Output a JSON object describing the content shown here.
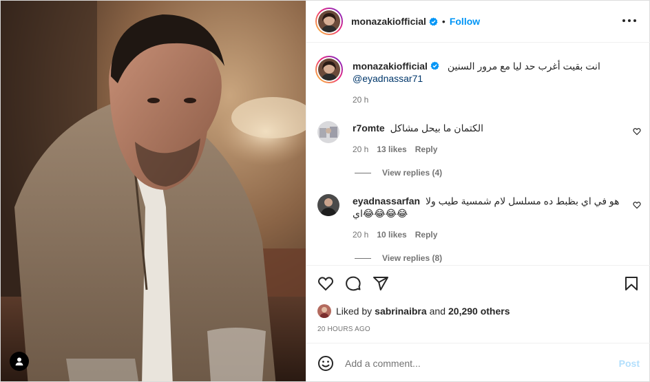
{
  "post": {
    "username": "monazakiofficial",
    "follow_label": "Follow",
    "separator": "•",
    "verified_icon": "verified-badge-icon",
    "more_icon": "more-options-icon"
  },
  "caption": {
    "username": "monazakiofficial",
    "text": "انت بقيت أغرب حد ليا مع مرور السنين",
    "mention": "@eyadnassar71",
    "time": "20 h"
  },
  "comments": [
    {
      "username": "r7omte",
      "text": "الكتمان ما بيحل مشاكل",
      "time": "20 h",
      "likes": "13 likes",
      "reply_label": "Reply",
      "view_replies": "View replies (4)"
    },
    {
      "username": "eyadnassarfan",
      "text": "هو في اي بظبط ده مسلسل لام شمسية طيب ولا اي😂😂😂😂",
      "time": "20 h",
      "likes": "10 likes",
      "reply_label": "Reply",
      "view_replies": "View replies (8)"
    }
  ],
  "actions": {
    "like_icon": "heart-icon",
    "comment_icon": "comment-icon",
    "share_icon": "share-icon",
    "save_icon": "bookmark-icon"
  },
  "likes": {
    "prefix": "Liked by",
    "user": "sabrinaibra",
    "and": "and",
    "others": "20,290 others"
  },
  "timestamp": "20 HOURS AGO",
  "add_comment": {
    "placeholder": "Add a comment...",
    "post_label": "Post",
    "emoji_icon": "emoji-icon"
  },
  "colors": {
    "accent": "#0095f6",
    "post_disabled": "#b2dffc",
    "muted": "#737373",
    "text": "#262626"
  }
}
